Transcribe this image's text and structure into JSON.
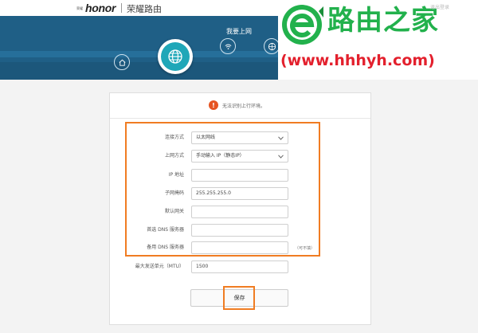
{
  "brand": {
    "logo_mark": "荣耀",
    "logo_text": "honor",
    "router_name": "荣耀路由"
  },
  "header": {
    "title": "我要上网",
    "nav_icons": [
      "home-icon",
      "globe-icon",
      "wifi-icon",
      "network-icon",
      "user-icon",
      "menu-icon"
    ],
    "active_icon": "globe-icon",
    "colors": {
      "header_bg": "#1f5f86",
      "active_circle": "#1fa7b8"
    }
  },
  "watermark": {
    "title": "路由之家",
    "url": "(www.hhhyh.com)",
    "faint_text": "退出登录",
    "colors": {
      "green": "#22b14c",
      "red": "#e3202d"
    }
  },
  "status": {
    "warning_text": "无法识别上行环境。",
    "warning_icon": "!"
  },
  "form": {
    "connection_type": {
      "label": "连接方式",
      "value": "以太网线"
    },
    "access_type": {
      "label": "上网方式",
      "value": "手动输入 IP（静态IP）"
    },
    "ip_address": {
      "label": "IP 地址",
      "value": ""
    },
    "subnet_mask": {
      "label": "子网掩码",
      "value": "255.255.255.0"
    },
    "gateway": {
      "label": "默认网关",
      "value": ""
    },
    "primary_dns": {
      "label": "首选 DNS 服务器",
      "value": ""
    },
    "secondary_dns": {
      "label": "备用 DNS 服务器",
      "value": "",
      "hint": "（可不填）"
    },
    "mtu": {
      "label": "最大发送单元（MTU）",
      "value": "1500"
    },
    "save_label": "保存"
  },
  "colors": {
    "highlight": "#f07c22",
    "warning": "#e65422"
  }
}
